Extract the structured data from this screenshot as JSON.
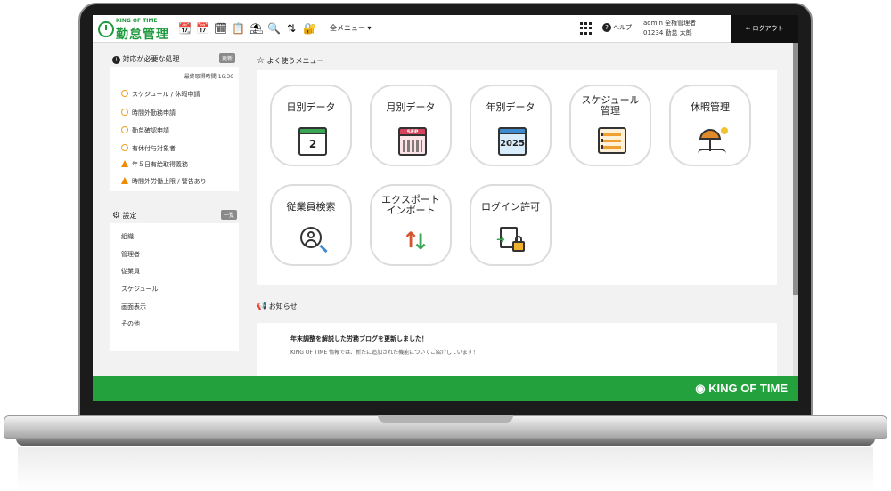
{
  "header": {
    "logo_small": "KING OF TIME",
    "logo_big": "勤怠管理",
    "menu_all": "全メニュー ▾",
    "help": "ヘルプ",
    "user_line1": "admin 全権管理者",
    "user_line2": "01234 勤怠 太郎",
    "logout": "ログアウト"
  },
  "sidebar": {
    "pending": {
      "title": "対応が必要な処理",
      "refresh_badge": "更新",
      "last_fetch": "最終取得時間 16:36",
      "items": [
        {
          "label": "スケジュール / 休暇申請",
          "icon": "clock-icon"
        },
        {
          "label": "時間外勤務申請",
          "icon": "clock-icon"
        },
        {
          "label": "勤怠確認申請",
          "icon": "clock-icon"
        },
        {
          "label": "有休付与対象者",
          "icon": "clock-icon"
        },
        {
          "label": "年５日有給取得義務",
          "icon": "warning-icon"
        },
        {
          "label": "時間外労働上限 / 警告あり",
          "icon": "warning-icon"
        }
      ]
    },
    "settings": {
      "title": "設定",
      "list_badge": "一覧",
      "items": [
        "組織",
        "管理者",
        "従業員",
        "スケジュール",
        "画面表示",
        "その他"
      ]
    }
  },
  "favorites": {
    "title": "よく使うメニュー",
    "tiles": [
      {
        "label": "日別データ",
        "art_text": "2"
      },
      {
        "label": "月別データ",
        "art_text": "SEP"
      },
      {
        "label": "年別データ",
        "art_text": "2025"
      },
      {
        "label": "スケジュール\n管理"
      },
      {
        "label": "休暇管理"
      },
      {
        "label": "従業員検索"
      },
      {
        "label": "エクスポート\nインポート"
      },
      {
        "label": "ログイン許可"
      }
    ]
  },
  "news": {
    "title": "お知らせ",
    "item_title": "年末調整を解説した労務ブログを更新しました！",
    "item_body": "KING OF TIME 情報では、新たに追加された機能についてご紹介しています！"
  },
  "footer": {
    "logo": "KING OF TIME"
  },
  "colors": {
    "brand_green": "#23a13d",
    "warning_orange": "#f08a00"
  }
}
